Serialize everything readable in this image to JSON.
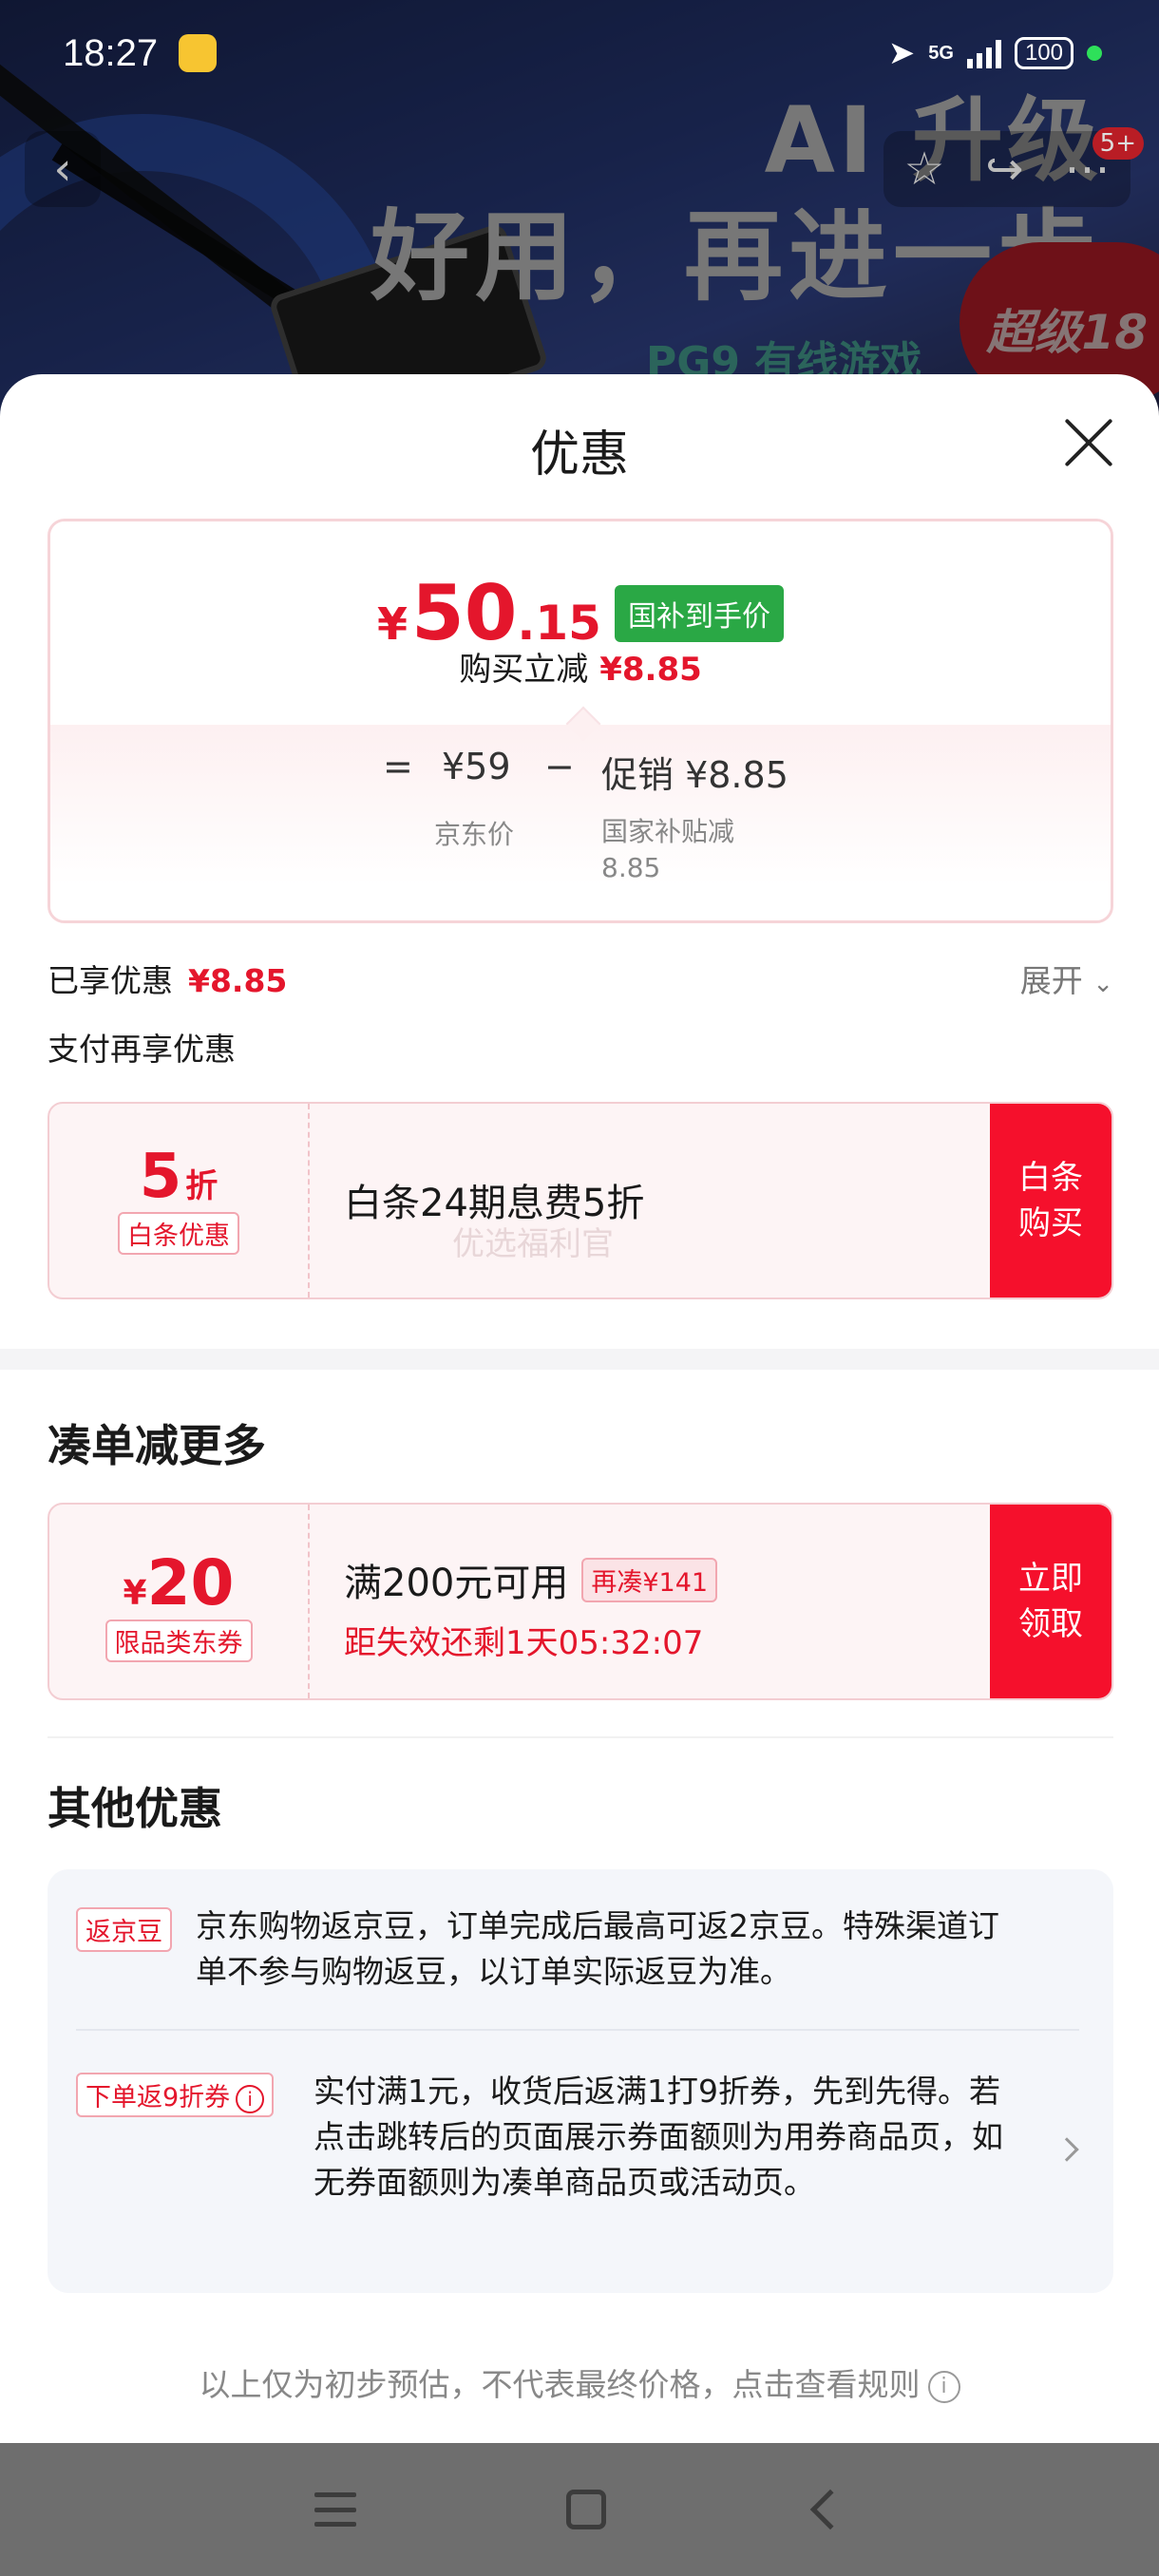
{
  "status": {
    "time": "18:27",
    "network": "5G",
    "battery": "100"
  },
  "banner": {
    "title_line1": "AI 升级",
    "title_line2": "好用，再进一步",
    "subtitle": "PG9 有线游戏",
    "badge_text": "超级18",
    "notification_count": "5+"
  },
  "sheet": {
    "title": "优惠"
  },
  "price_card": {
    "currency": "¥",
    "price_int": "50",
    "price_dec": ".15",
    "price_tag": "国补到手价",
    "reduce_label": "购买立减",
    "reduce_value": "¥8.85",
    "eq": "=",
    "jd_price": "¥59",
    "minus": "−",
    "promo": "促销 ¥8.85",
    "jd_price_label": "京东价",
    "promo_label": "国家补贴减8.85"
  },
  "enjoyed": {
    "label": "已享优惠",
    "value": "¥8.85",
    "expand_label": "展开"
  },
  "pay_more": {
    "label": "支付再享优惠"
  },
  "baitiao": {
    "discount_num": "5",
    "discount_unit": "折",
    "tag": "白条优惠",
    "text": "白条24期息费5折",
    "watermark": "优选福利官",
    "button": "白条购买"
  },
  "section1": {
    "title": "凑单减更多"
  },
  "jd_coupon": {
    "currency": "¥",
    "amount": "20",
    "tag": "限品类东券",
    "condition": "满200元可用",
    "more_tag": "再凑¥141",
    "expire": "距失效还剩1天05:32:07",
    "button": "立即领取"
  },
  "section2": {
    "title": "其他优惠"
  },
  "other": [
    {
      "tag": "返京豆",
      "text": "京东购物返京豆，订单完成后最高可返2京豆。特殊渠道订单不参与购物返豆，以订单实际返豆为准。"
    },
    {
      "tag": "下单返9折券",
      "info": "i",
      "text": "实付满1元，收货后返满1打9折券，先到先得。若点击跳转后的页面展示券面额则为用券商品页，如无券面额则为凑单商品页或活动页。"
    }
  ],
  "disclaimer": {
    "text": "以上仅为初步预估，不代表最终价格，点击查看规则",
    "info": "i"
  }
}
